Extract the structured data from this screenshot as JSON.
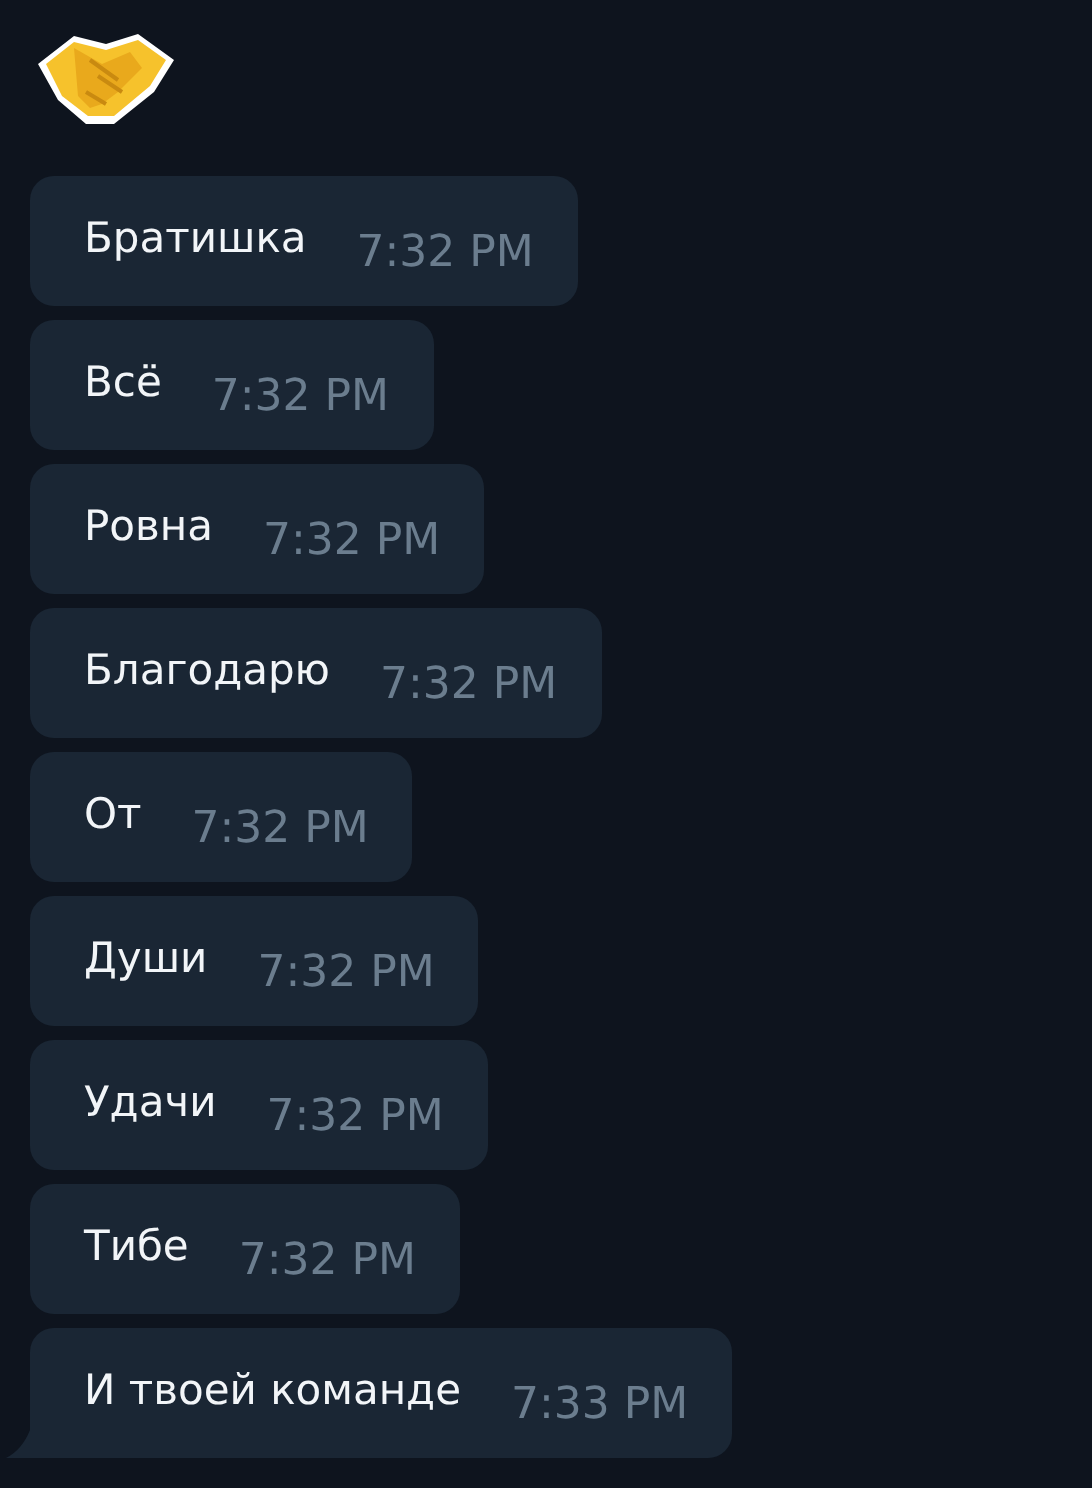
{
  "sticker": {
    "kind": "emoji"
  },
  "messages": [
    {
      "text": "Братишка",
      "time": "7:32 PM",
      "tail": false
    },
    {
      "text": "Всё",
      "time": "7:32 PM",
      "tail": false
    },
    {
      "text": "Ровна",
      "time": "7:32 PM",
      "tail": false
    },
    {
      "text": "Благодарю",
      "time": "7:32 PM",
      "tail": false
    },
    {
      "text": "От",
      "time": "7:32 PM",
      "tail": false
    },
    {
      "text": "Души",
      "time": "7:32 PM",
      "tail": false
    },
    {
      "text": "Удачи",
      "time": "7:32 PM",
      "tail": false
    },
    {
      "text": "Тибе",
      "time": "7:32 PM",
      "tail": false
    },
    {
      "text": "И твоей команде",
      "time": "7:33 PM",
      "tail": true
    }
  ]
}
